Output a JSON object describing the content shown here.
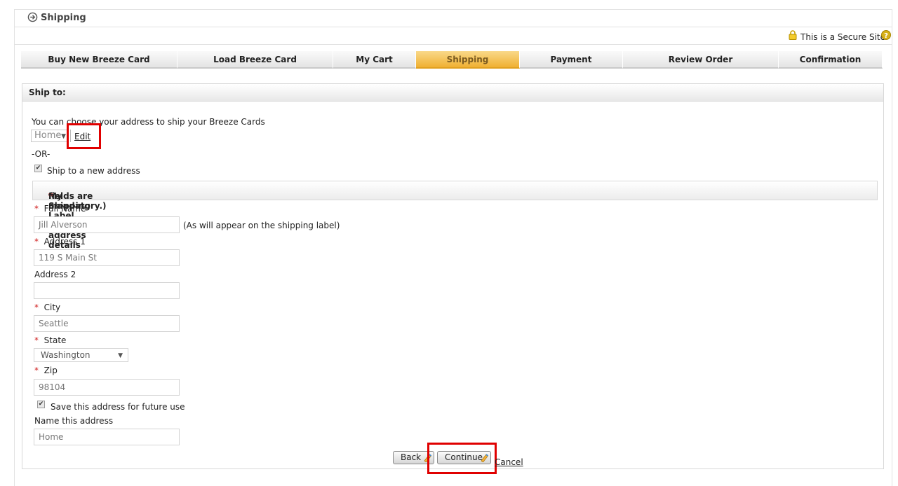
{
  "page": {
    "title": "Shipping",
    "secure_text": "This is a Secure Site"
  },
  "steps": [
    {
      "label": "Buy New Breeze Card",
      "active": false
    },
    {
      "label": "Load Breeze Card",
      "active": false
    },
    {
      "label": "My Cart",
      "active": false
    },
    {
      "label": "Shipping",
      "active": true
    },
    {
      "label": "Payment",
      "active": false
    },
    {
      "label": "Review Order",
      "active": false
    },
    {
      "label": "Confirmation",
      "active": false
    }
  ],
  "ship_to": {
    "heading": "Ship to:",
    "intro": "You can choose your address to ship your Breeze Cards",
    "address_select": "Home",
    "edit_label": "Edit",
    "or_label": "-OR-",
    "new_address_label": "Ship to a new address",
    "new_address_checked": true
  },
  "label_section": {
    "heading_pre": "My Shipping Label (Enter address details where ",
    "heading_star": "*",
    "heading_post": " fields are mandatory.)"
  },
  "form": {
    "full_name_label": "Full Name",
    "full_name_value": "Jill Alverson",
    "full_name_hint": "(As will appear on the shipping label)",
    "address1_label": "Address 1",
    "address1_value": "119 S Main St",
    "address2_label": "Address 2",
    "address2_value": "",
    "city_label": "City",
    "city_value": "Seattle",
    "state_label": "State",
    "state_value": "Washington",
    "zip_label": "Zip",
    "zip_value": "98104",
    "save_label": "Save this address for future use",
    "save_checked": true,
    "name_address_label": "Name this address",
    "name_address_value": "Home",
    "required_mark": "*"
  },
  "actions": {
    "back_label": "Back",
    "continue_label": "Continue",
    "cancel_label": "Cancel"
  },
  "colors": {
    "active_step": "#f0b032",
    "highlight": "#e00000",
    "required": "#d02020"
  }
}
